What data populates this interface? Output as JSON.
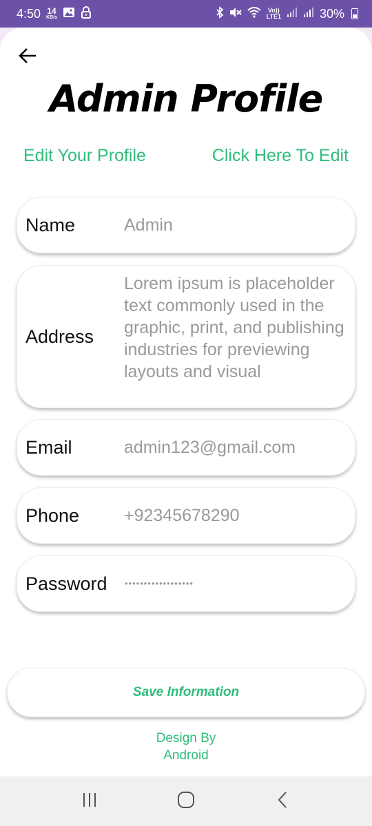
{
  "status_bar": {
    "time": "4:50",
    "speed_value": "14",
    "speed_unit": "KB/s",
    "volte_top": "Vo))",
    "volte_bottom": "LTE1",
    "battery": "30%",
    "icons": [
      "image-icon",
      "lock-icon",
      "bluetooth-icon",
      "mute-icon",
      "wifi-icon",
      "signal-icon",
      "signal-icon",
      "battery-icon"
    ]
  },
  "header": {
    "back_icon": "back-arrow-icon",
    "title": "Admin Profile"
  },
  "edit_row": {
    "left_label": "Edit Your Profile",
    "right_link": "Click Here To Edit"
  },
  "fields": {
    "name": {
      "label": "Name",
      "value": "Admin"
    },
    "address": {
      "label": "Address",
      "value": "Lorem ipsum is placeholder text commonly used in the graphic, print, and publishing industries for previewing layouts and visual"
    },
    "email": {
      "label": "Email",
      "value": "admin123@gmail.com"
    },
    "phone": {
      "label": "Phone",
      "value": "+92345678290"
    },
    "password": {
      "label": "Password",
      "value": "••••••••••••••••••"
    }
  },
  "save_button": "Save Information",
  "credit": {
    "line1": "Design By",
    "line2": "Android"
  },
  "nav": {
    "icons": [
      "recents-icon",
      "home-icon",
      "back-icon"
    ]
  },
  "colors": {
    "status_bar": "#6b52a8",
    "accent": "#2ebd7a",
    "value_text": "#9a9a9a"
  }
}
